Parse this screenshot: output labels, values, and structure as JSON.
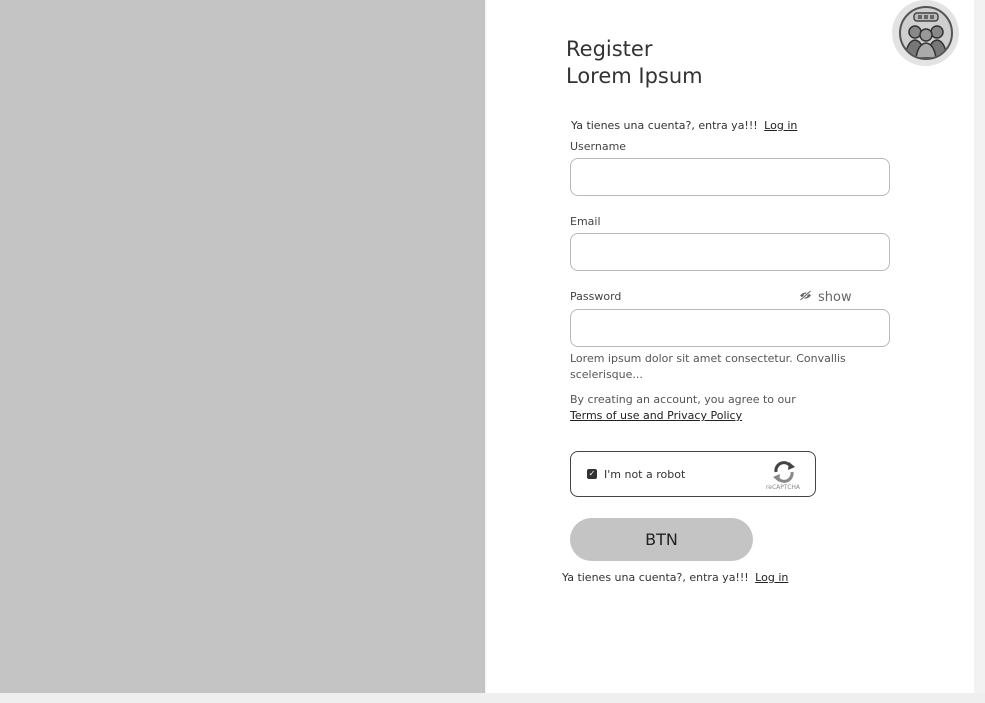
{
  "header": {
    "title_line1": "Register",
    "title_line2": "Lorem Ipsum"
  },
  "top_login": {
    "prompt": "Ya tienes una cuenta?, entra ya!!!",
    "link": "Log in"
  },
  "fields": {
    "username_label": "Username",
    "username_value": "",
    "email_label": "Email",
    "email_value": "",
    "password_label": "Password",
    "password_value": "",
    "show_label": "show"
  },
  "password_hint": "Lorem ipsum dolor sit amet consectetur. Convallis scelerisque...",
  "terms": {
    "text": "By creating an account, you agree to our",
    "link": "Terms of use and Privacy Policy"
  },
  "captcha": {
    "label": "I'm not a robot",
    "brand": "reCAPTCHA"
  },
  "submit_label": "BTN",
  "bottom_login": {
    "prompt": "Ya tienes una cuenta?, entra ya!!!",
    "link": "Log in"
  },
  "colors": {
    "image_placeholder": "#c4c4c4",
    "button_bg": "#c4c4c4",
    "panel_bg": "#ffffff",
    "page_bg": "#f2f2f2"
  }
}
